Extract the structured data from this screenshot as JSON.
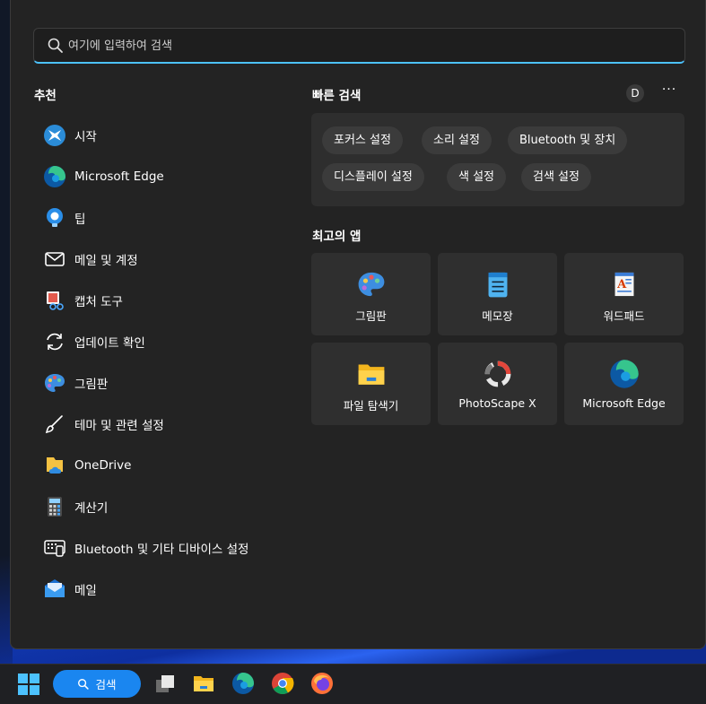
{
  "search": {
    "placeholder": "여기에 입력하여 검색"
  },
  "recommended": {
    "title": "추천",
    "items": [
      {
        "label": "시작",
        "icon": "get-started-icon"
      },
      {
        "label": "Microsoft Edge",
        "icon": "edge-icon"
      },
      {
        "label": "팁",
        "icon": "tips-bulb-icon"
      },
      {
        "label": "메일 및 계정",
        "icon": "mail-outline-icon"
      },
      {
        "label": "캡처 도구",
        "icon": "snipping-tool-icon"
      },
      {
        "label": "업데이트 확인",
        "icon": "refresh-icon"
      },
      {
        "label": "그림판",
        "icon": "paint-palette-icon"
      },
      {
        "label": "테마 및 관련 설정",
        "icon": "brush-icon"
      },
      {
        "label": "OneDrive",
        "icon": "onedrive-icon"
      },
      {
        "label": "계산기",
        "icon": "calculator-icon"
      },
      {
        "label": "Bluetooth 및 기타 디바이스 설정",
        "icon": "keyboard-device-icon"
      },
      {
        "label": "메일",
        "icon": "mail-app-icon"
      }
    ]
  },
  "quick_search": {
    "title": "빠른 검색",
    "avatar": "D",
    "more": "···",
    "chips": [
      "포커스 설정",
      "소리 설정",
      "Bluetooth 및 장치",
      "디스플레이 설정",
      "색 설정",
      "검색 설정"
    ]
  },
  "top_apps": {
    "title": "최고의 앱",
    "apps": [
      {
        "label": "그림판",
        "icon": "paint-palette-icon"
      },
      {
        "label": "메모장",
        "icon": "notepad-icon"
      },
      {
        "label": "워드패드",
        "icon": "wordpad-icon"
      },
      {
        "label": "파일 탐색기",
        "icon": "file-explorer-icon"
      },
      {
        "label": "PhotoScape X",
        "icon": "photoscape-icon"
      },
      {
        "label": "Microsoft Edge",
        "icon": "edge-icon"
      }
    ]
  },
  "taskbar": {
    "search_label": "검색",
    "icons": [
      "windows-start-icon",
      "task-view-icon",
      "file-explorer-icon",
      "edge-icon",
      "chrome-icon",
      "firefox-icon"
    ]
  },
  "colors": {
    "accent": "#4cc2ff",
    "taskbar_search": "#1a86f0",
    "panel": "#232323"
  }
}
